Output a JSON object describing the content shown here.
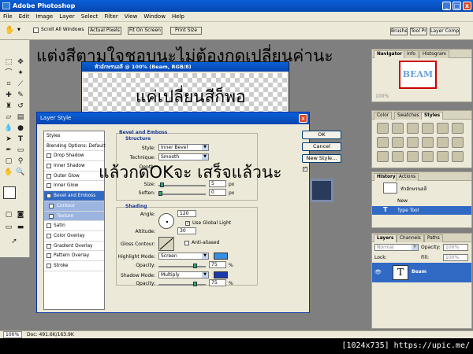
{
  "app": {
    "title": "Adobe Photoshop",
    "win_buttons": [
      "_",
      "□",
      "x"
    ]
  },
  "menu": [
    "File",
    "Edit",
    "Image",
    "Layer",
    "Select",
    "Filter",
    "View",
    "Window",
    "Help"
  ],
  "options_bar": {
    "scroll_all_windows": "Scroll All Windows",
    "actual_pixels": "Actual Pixels",
    "fit_on_screen": "Fit On Screen",
    "print_size": "Print Size",
    "tabs": [
      "Brushes",
      "Tool Pr",
      "Layer Comps"
    ]
  },
  "document": {
    "title": "หัวอักษรนอลี @ 100% (Beam, RGB/8)"
  },
  "overlay_text": {
    "line1": "แต่งสีตามใจชอบนะไม่ต้องกดเปลี่ยนค่านะ",
    "line2": "แค่เปลี่ยนสีก็พอ",
    "line3": "แล้วกดOKจะ  เสร็จแล้วนะ"
  },
  "layer_style": {
    "title": "Layer Style",
    "styles_header": "Styles",
    "blending_options": "Blending Options: Default",
    "items": [
      {
        "label": "Drop Shadow",
        "checked": false
      },
      {
        "label": "Inner Shadow",
        "checked": false
      },
      {
        "label": "Outer Glow",
        "checked": false
      },
      {
        "label": "Inner Glow",
        "checked": false
      },
      {
        "label": "Bevel and Emboss",
        "checked": true
      },
      {
        "label": "Contour",
        "checked": false
      },
      {
        "label": "Texture",
        "checked": false
      },
      {
        "label": "Satin",
        "checked": false
      },
      {
        "label": "Color Overlay",
        "checked": false
      },
      {
        "label": "Gradient Overlay",
        "checked": false
      },
      {
        "label": "Pattern Overlay",
        "checked": false
      },
      {
        "label": "Stroke",
        "checked": false
      }
    ],
    "bevel": {
      "section_title": "Bevel and Emboss",
      "structure": "Structure",
      "style_label": "Style:",
      "style_value": "Inner Bevel",
      "technique_label": "Technique:",
      "technique_value": "Smooth",
      "depth_label": "Depth:",
      "size_label": "Size:",
      "size_value": "5",
      "size_unit": "px",
      "soften_label": "Soften:",
      "soften_value": "0",
      "soften_unit": "px"
    },
    "shading": {
      "title": "Shading",
      "angle_label": "Angle:",
      "angle_value": "120",
      "use_global_light": "Use Global Light",
      "altitude_label": "Altitude:",
      "altitude_value": "30",
      "gloss_label": "Gloss Contour:",
      "anti_aliased": "Anti-aliased",
      "highlight_label": "Highlight Mode:",
      "highlight_value": "Screen",
      "opacity_label": "Opacity:",
      "opacity1_value": "75",
      "shadow_label": "Shadow Mode:",
      "shadow_value": "Multiply",
      "opacity2_value": "75",
      "pct": "%",
      "highlight_color": "#3a8ee0",
      "shadow_color": "#1a3aa8"
    },
    "buttons": {
      "ok": "OK",
      "cancel": "Cancel",
      "new_style": "New Style..."
    }
  },
  "navigator": {
    "tabs": [
      "Navigator",
      "Info",
      "Histogram"
    ],
    "thumb_text": "BEAM",
    "zoom": "100%"
  },
  "styles_panel": {
    "tabs": [
      "Color",
      "Swatches",
      "Styles"
    ]
  },
  "history": {
    "tabs": [
      "History",
      "Actions"
    ],
    "snapshot": "หัวอักษรนอลี",
    "items": [
      "New",
      "Type Tool"
    ]
  },
  "layers": {
    "tabs": [
      "Layers",
      "Channels",
      "Paths"
    ],
    "blend": "Normal",
    "opacity_label": "Opacity:",
    "opacity_value": "100%",
    "lock_label": "Lock:",
    "fill_label": "Fill:",
    "fill_value": "100%",
    "layer_name": "Beam",
    "layer_glyph": "T"
  },
  "status": {
    "zoom": "100%",
    "doc": "Doc: 491.6K/163.9K"
  },
  "watermark": "[1024x735] https://upic.me/"
}
